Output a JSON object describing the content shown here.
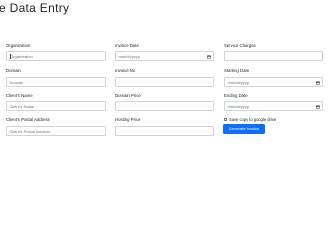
{
  "page": {
    "title": "e Data Entry"
  },
  "form": {
    "column1": {
      "organization": {
        "label": "Organization",
        "placeholder": "Organization"
      },
      "domain": {
        "label": "Domain",
        "placeholder": "Domain"
      },
      "client_name": {
        "label": "Client's Name",
        "placeholder": "Client's Name"
      },
      "client_postal_address": {
        "label": "Client's Postal Address",
        "placeholder": "Client's Postal Address"
      }
    },
    "column2": {
      "invoice_date": {
        "label": "Invoice Date",
        "value": "mm/dd/yyyy"
      },
      "invoice_no": {
        "label": "Invoice No",
        "value": ""
      },
      "domain_price": {
        "label": "Domain Price",
        "value": ""
      },
      "hosting_price": {
        "label": "Hosting Price",
        "value": ""
      }
    },
    "column3": {
      "service_charges": {
        "label": "Service Charges",
        "value": ""
      },
      "starting_date": {
        "label": "Starting Date",
        "value": "mm/dd/yyyy"
      },
      "ending_date": {
        "label": "Ending Date",
        "value": "mm/dd/yyyy"
      },
      "save_copy_label": "Save copy to google drive",
      "save_copy_checked": false,
      "generate_button_label": "Generate Invoice"
    }
  },
  "colors": {
    "primary": "#0d6efd",
    "border": "#ced4da",
    "placeholder": "#6c757d",
    "text": "#212529"
  }
}
